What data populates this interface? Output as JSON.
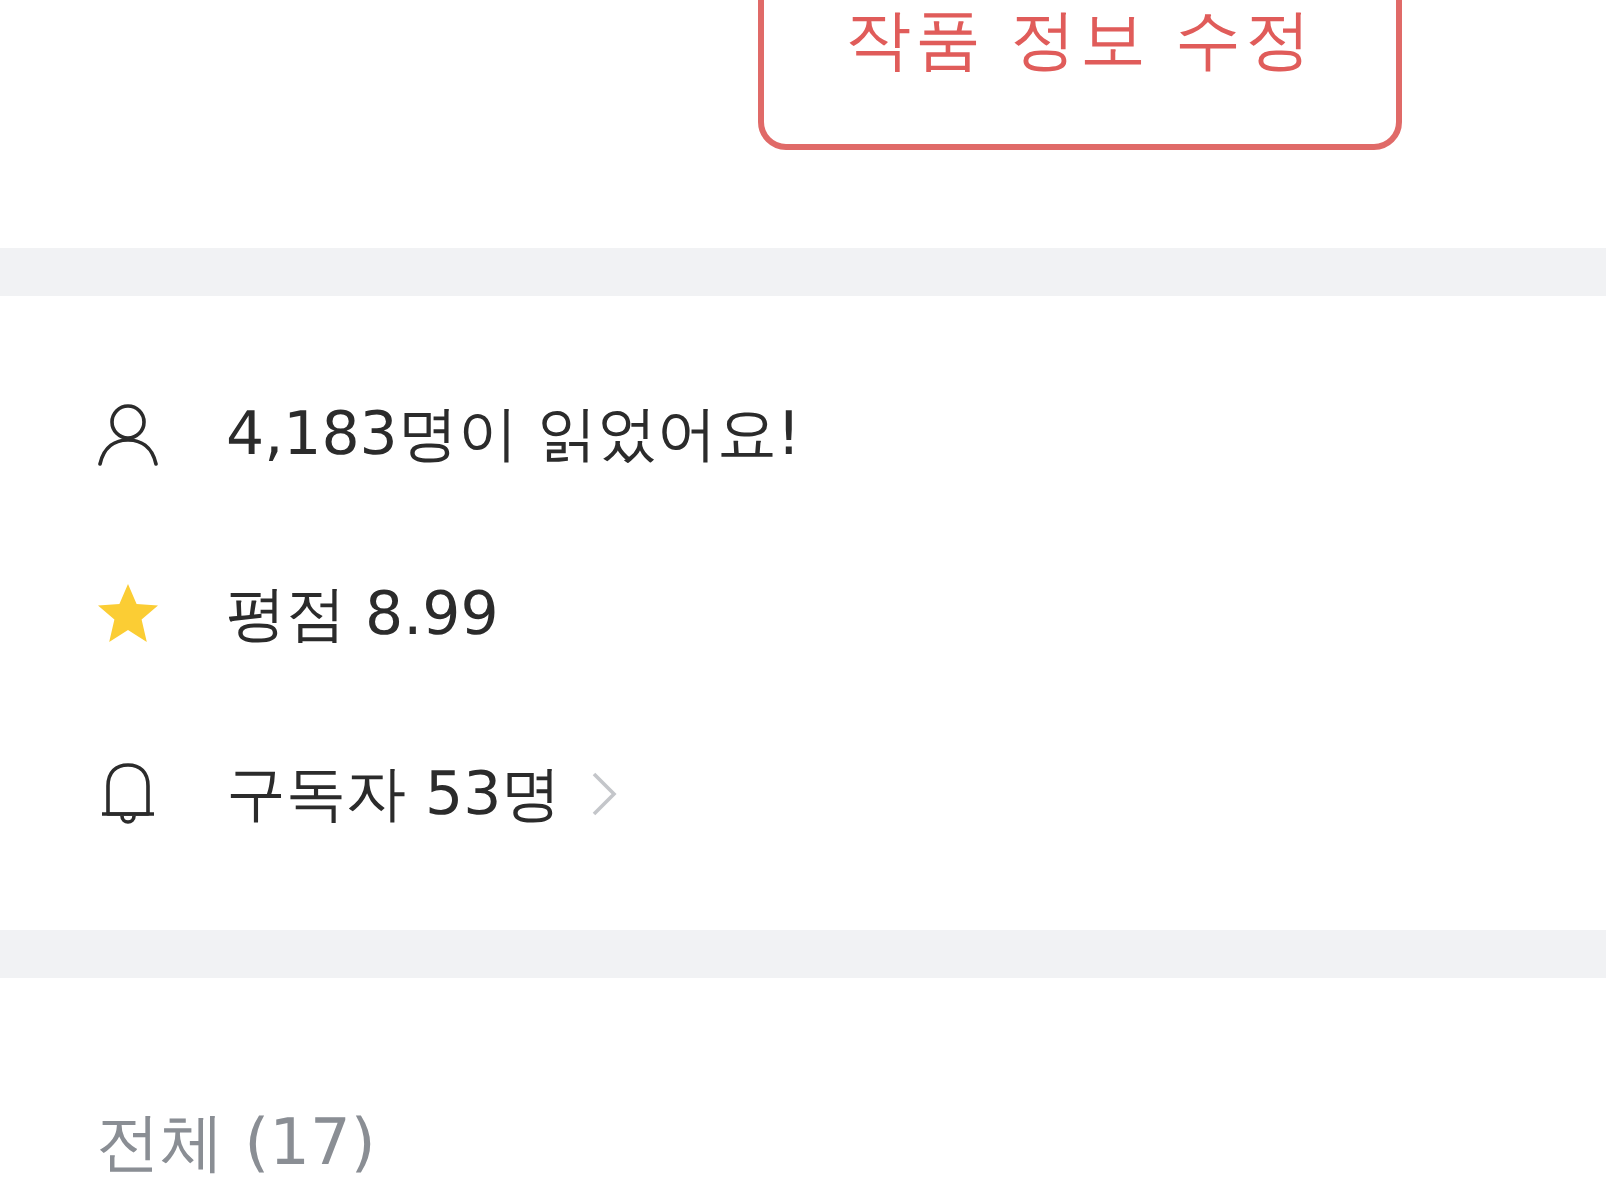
{
  "edit_button": {
    "label": "작품 정보 수정"
  },
  "stats": [
    {
      "kind": "readers",
      "text": "4,183명이 읽었어요!",
      "chevron": false
    },
    {
      "kind": "rating",
      "text": "평점 8.99",
      "chevron": false
    },
    {
      "kind": "subscribers",
      "text": "구독자 53명",
      "chevron": true
    }
  ],
  "episodes_header": {
    "label": "전체 (17)"
  }
}
